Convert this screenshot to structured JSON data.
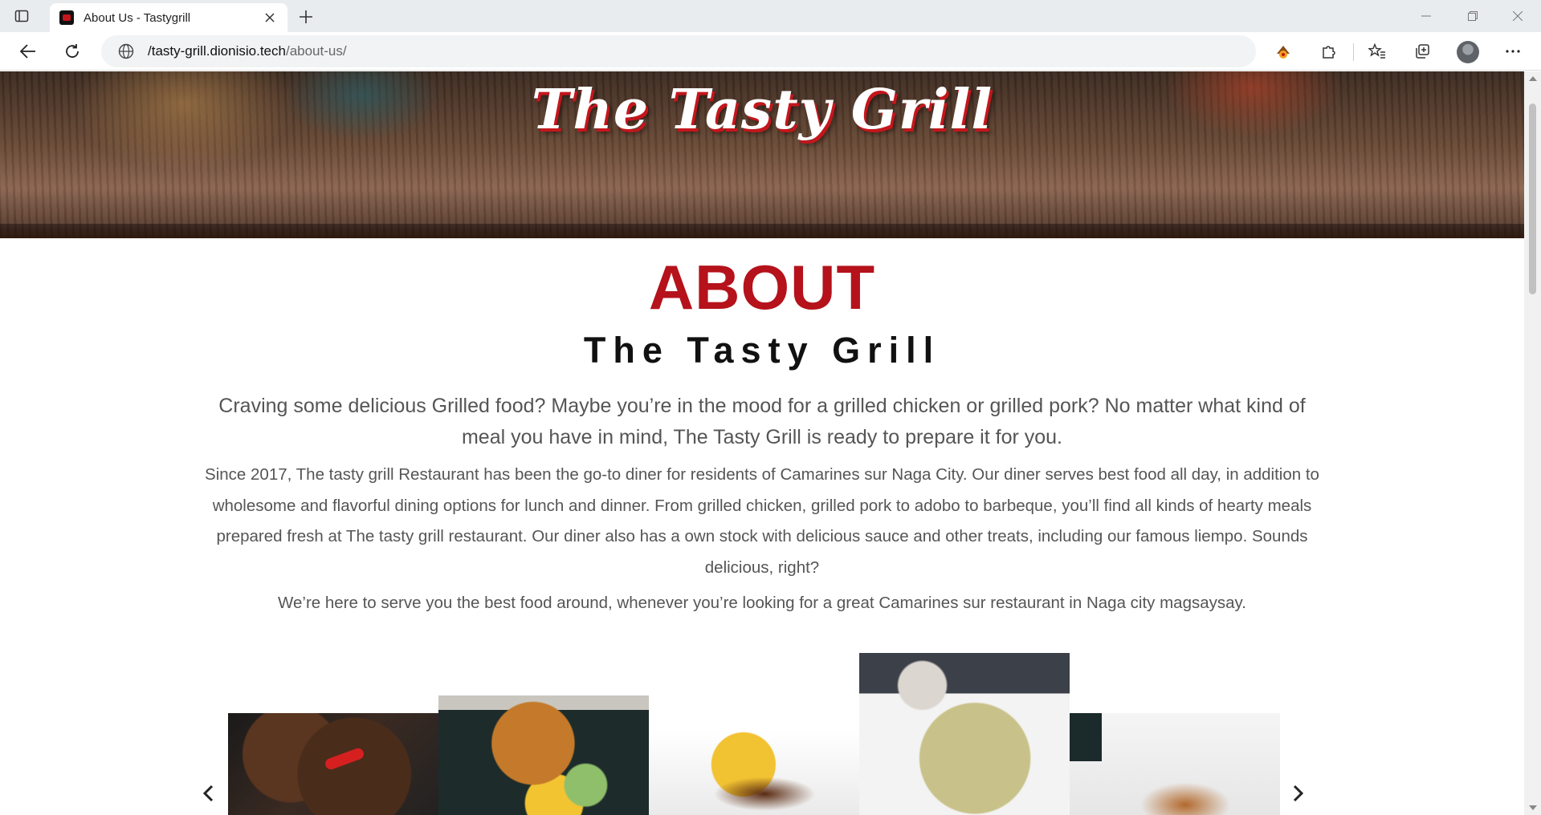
{
  "browser": {
    "tab_title": "About Us - Tastygrill",
    "url_host": "/tasty-grill.dionisio.tech",
    "url_path": "/about-us/"
  },
  "hero": {
    "logo_text": "The Tasty Grill"
  },
  "about": {
    "heading": "ABOUT",
    "subheading": "The Tasty Grill",
    "lead": "Craving some delicious Grilled food? Maybe you’re in the mood for a grilled chicken or grilled pork? No matter what kind of meal you have in mind, The Tasty Grill is ready to prepare it for you.",
    "body1": "Since 2017, The tasty grill Restaurant has been the go-to diner for residents of Camarines sur Naga City. Our diner serves best food all day, in addition to wholesome and flavorful dining options for lunch and dinner. From grilled chicken, grilled pork to adobo to barbeque, you’ll find all kinds of hearty meals prepared fresh at The tasty grill restaurant. Our diner also has a own stock with delicious sauce and other treats, including our famous liempo. Sounds delicious, right?",
    "body2": "We’re here to serve you the best food around, whenever you’re looking for a great Camarines sur restaurant in Naga city magsaysay."
  },
  "gallery": {
    "items": [
      "sizzling-pork-photo",
      "grilled-chicken-plate-photo",
      "pork-belly-rice-photo",
      "seafood-dish-photo",
      "grilled-liempo-box-photo"
    ]
  },
  "colors": {
    "accent_red": "#b5121b",
    "text_gray": "#555555",
    "heading_dark": "#111111"
  }
}
